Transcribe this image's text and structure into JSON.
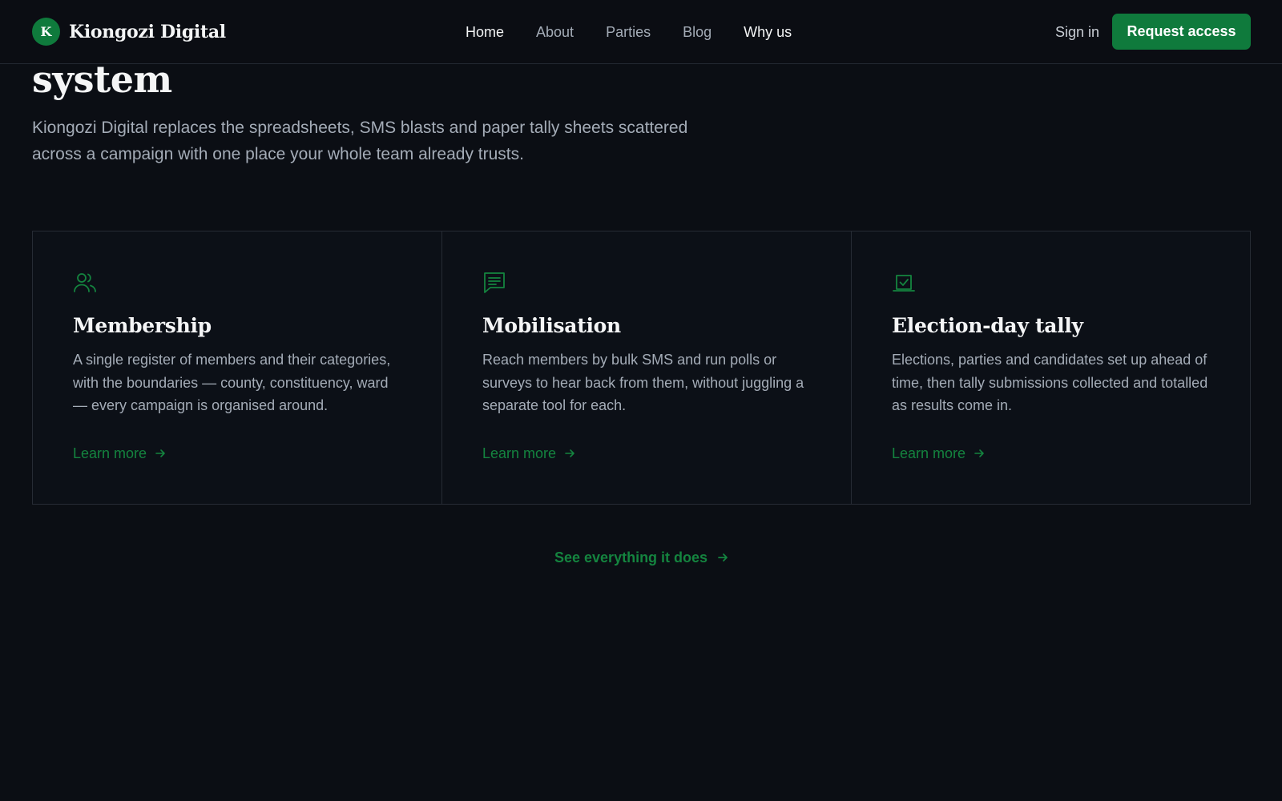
{
  "header": {
    "brand_initial": "K",
    "brand_name": "Kiongozi Digital",
    "nav": [
      {
        "label": "Home"
      },
      {
        "label": "About"
      },
      {
        "label": "Parties"
      },
      {
        "label": "Blog"
      },
      {
        "label": "Why us"
      }
    ],
    "signin_label": "Sign in",
    "cta_label": "Request access"
  },
  "hero": {
    "title_visible": "system",
    "subtitle": "Kiongozi Digital replaces the spreadsheets, SMS blasts and paper tally sheets scattered across a campaign with one place your whole team already trusts."
  },
  "features": [
    {
      "icon": "users-icon",
      "title": "Membership",
      "text": "A single register of members and their categories, with the boundaries — county, constituency, ward — every campaign is organised around.",
      "link": "Learn more"
    },
    {
      "icon": "message-icon",
      "title": "Mobilisation",
      "text": "Reach members by bulk SMS and run polls or surveys to hear back from them, without juggling a separate tool for each.",
      "link": "Learn more"
    },
    {
      "icon": "ballot-box-icon",
      "title": "Election-day tally",
      "text": "Elections, parties and candidates set up ahead of time, then tally submissions collected and totalled as results come in.",
      "link": "Learn more"
    }
  ],
  "see_all_label": "See everything it does",
  "colors": {
    "background": "#0b0e14",
    "accent": "#0f7a3c",
    "accent_text": "#14843f",
    "border": "#262b34"
  }
}
